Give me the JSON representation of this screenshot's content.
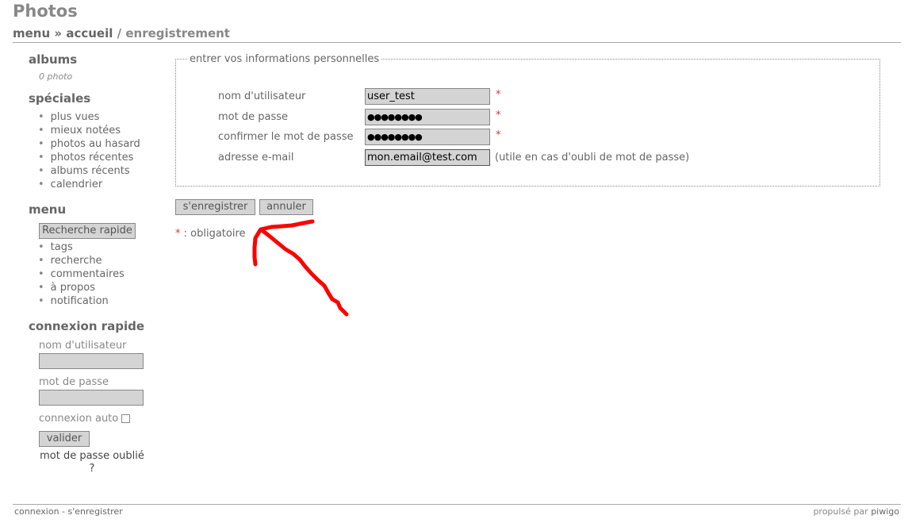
{
  "site": {
    "title": "Photos"
  },
  "breadcrumb": {
    "menu": "menu",
    "sep1": "»",
    "home": "accueil",
    "sep2": "/",
    "current": "enregistrement"
  },
  "sidebar": {
    "albums": {
      "title": "albums",
      "count": "0 photo"
    },
    "specials": {
      "title": "spéciales",
      "items": [
        "plus vues",
        "mieux notées",
        "photos au hasard",
        "photos récentes",
        "albums récents",
        "calendrier"
      ]
    },
    "menu": {
      "title": "menu",
      "quick_search": "Recherche rapide",
      "items": [
        "tags",
        "recherche",
        "commentaires",
        "à propos",
        "notification"
      ]
    },
    "login": {
      "title": "connexion rapide",
      "username_label": "nom d'utilisateur",
      "password_label": "mot de passe",
      "auto_label": "connexion auto",
      "submit": "valider",
      "forgot": "mot de passe oublié ?"
    }
  },
  "form": {
    "legend": "entrer vos informations personnelles",
    "fields": [
      {
        "label": "nom d'utilisateur",
        "value": "user_test",
        "required": "*"
      },
      {
        "label": "mot de passe",
        "value": "●●●●●●●●",
        "required": "*"
      },
      {
        "label": "confirmer le mot de passe",
        "value": "●●●●●●●●",
        "required": "*"
      },
      {
        "label": "adresse e-mail",
        "value": "mon.email@test.com",
        "hint": "(utile en cas d'oubli de mot de passe)"
      }
    ],
    "register_button": "s'enregistrer",
    "cancel_button": "annuler",
    "required_star": "*",
    "required_note": ": obligatoire"
  },
  "annotation": {
    "color": "#ff0000"
  },
  "footer": {
    "links": "connexion - s'enregistrer",
    "powered": "propulsé par",
    "brand": "piwigo"
  }
}
